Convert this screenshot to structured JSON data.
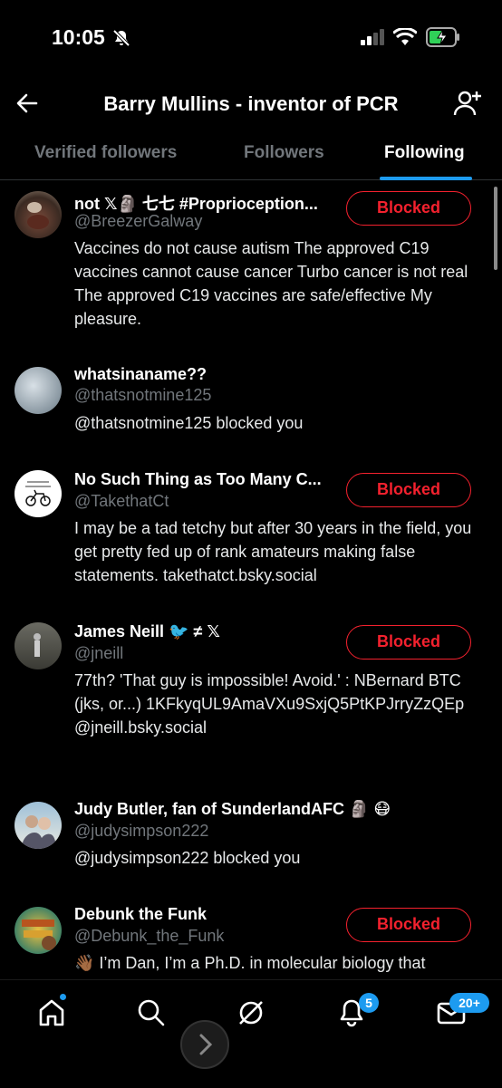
{
  "status_bar": {
    "time": "10:05"
  },
  "header": {
    "title": "Barry Mullins - inventor of PCR"
  },
  "tabs": [
    {
      "label": "Verified followers"
    },
    {
      "label": "Followers"
    },
    {
      "label": "Following"
    }
  ],
  "users": [
    {
      "name": "not 𝕏🗿 七七 #Proprioception...",
      "handle": "@BreezerGalway",
      "bio": "Vaccines do not cause autism The approved C19 vaccines cannot cause cancer Turbo cancer is not real The approved C19 vaccines are safe/effective My pleasure.",
      "button": "Blocked"
    },
    {
      "name": "whatsinaname??",
      "handle": "@thatsnotmine125",
      "bio": "@thatsnotmine125 blocked you"
    },
    {
      "name": "No Such Thing as Too Many C...",
      "handle": "@TakethatCt",
      "bio": "I may be a tad tetchy but after 30 years in the field, you get pretty fed up of rank amateurs making false statements. takethatct.bsky.social",
      "button": "Blocked"
    },
    {
      "name": "James Neill 🐦 ≠ 𝕏",
      "handle": "@jneill",
      "bio": "77th? 'That guy is impossible! Avoid.' : NBernard BTC (jks, or...) 1KFkyqUL9AmaVXu9SxjQ5PtKPJrryZzQEp @jneill.bsky.social",
      "button": "Blocked"
    },
    {
      "name": "Judy Butler, fan of SunderlandAFC 🗿 😷",
      "handle": "@judysimpson222",
      "bio": "@judysimpson222 blocked you"
    },
    {
      "name": "Debunk the Funk",
      "handle": "@Debunk_the_Funk",
      "bio": "👋🏾 I’m Dan, I’m a Ph.D. in molecular biology that",
      "button": "Blocked"
    }
  ],
  "bottom_nav": {
    "items": [
      {
        "icon": "home-icon"
      },
      {
        "icon": "search-icon"
      },
      {
        "icon": "grok-icon"
      },
      {
        "icon": "notifications-icon"
      },
      {
        "icon": "messages-icon"
      }
    ],
    "notifications_badge": "5",
    "messages_badge": "20+"
  },
  "colors": {
    "accent": "#1d9bf0",
    "blocked_red": "#f4212e",
    "muted": "#71767b"
  }
}
